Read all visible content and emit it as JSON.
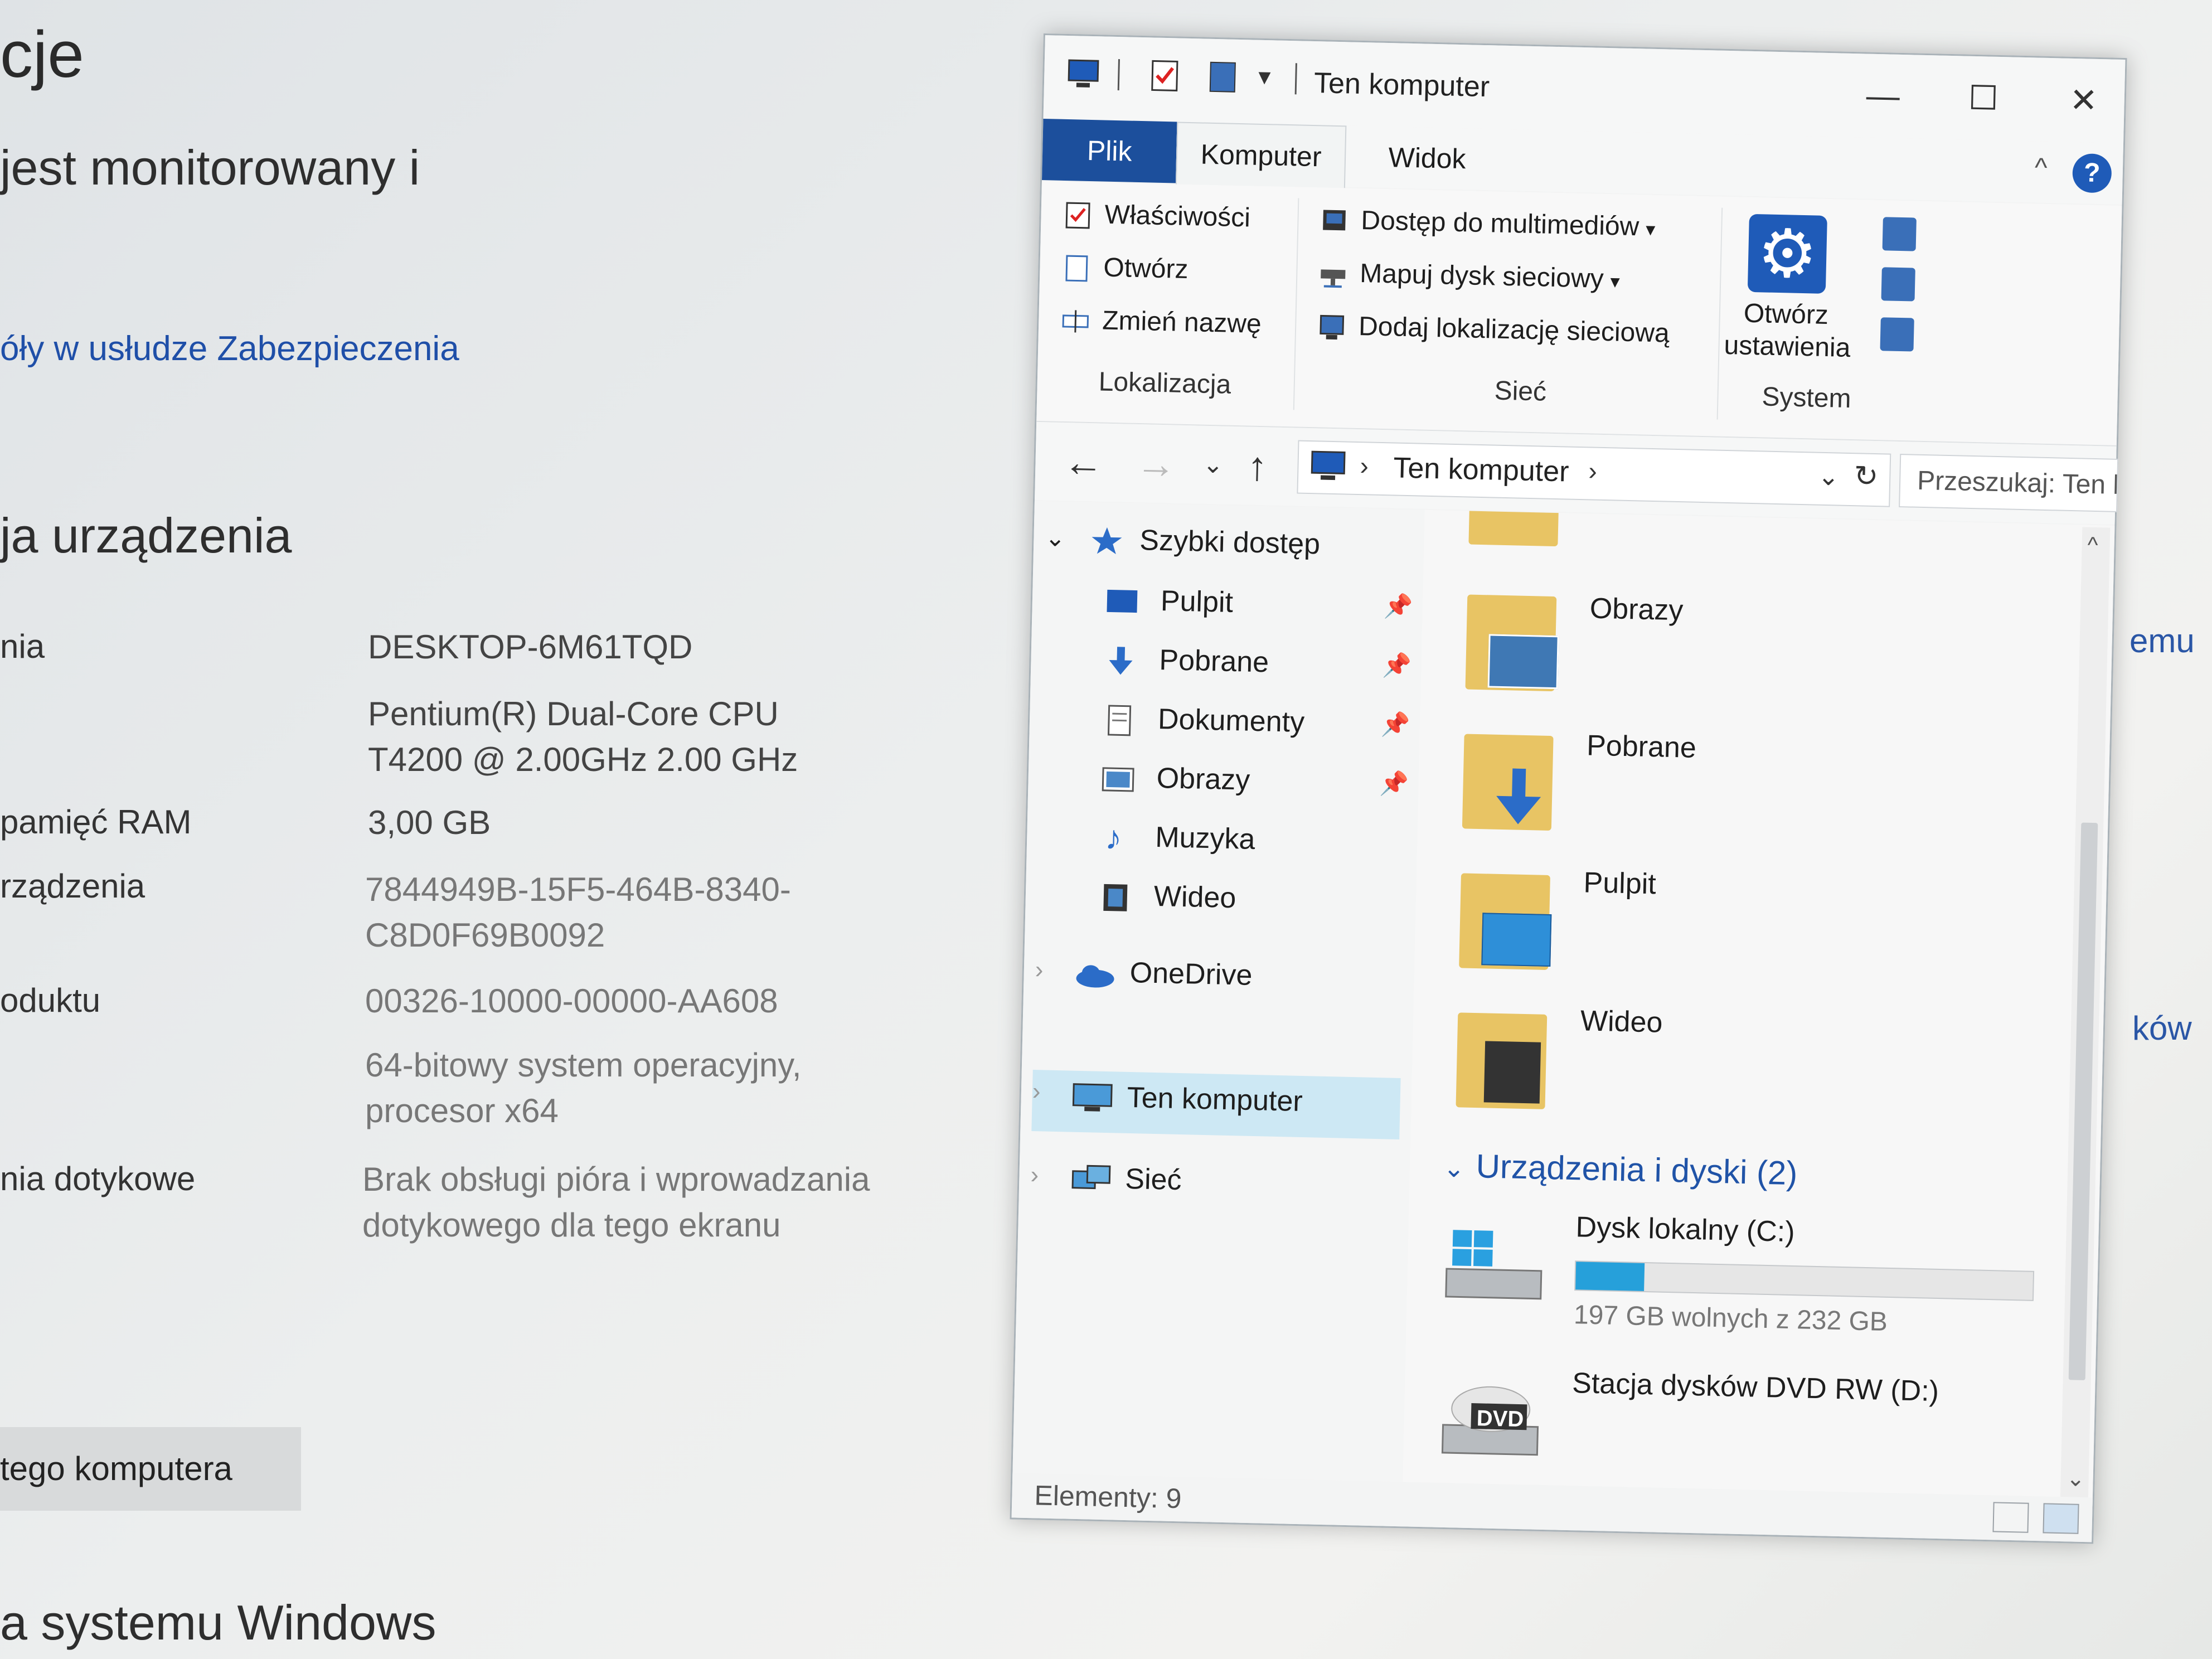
{
  "background": {
    "heading_partial": "cje",
    "subtitle_partial": "jest monitorowany i",
    "security_link": "óły w usłudze Zabezpieczenia",
    "device_section_title": "ja urządzenia",
    "specs": [
      {
        "label": "nia",
        "value": "DESKTOP-6M61TQD"
      },
      {
        "label": "",
        "value": "Pentium(R) Dual-Core CPU T4200  @ 2.00GHz   2.00 GHz"
      },
      {
        "label": "pamięć RAM",
        "value": "3,00 GB"
      },
      {
        "label": "rządzenia",
        "value": "7844949B-15F5-464B-8340-C8D0F69B0092"
      },
      {
        "label": "oduktu",
        "value": "00326-10000-00000-AA608"
      },
      {
        "label": "",
        "value": "64-bitowy system operacyjny, procesor x64"
      },
      {
        "label": "nia dotykowe",
        "value": "Brak obsługi pióra i wprowadzania dotykowego dla tego ekranu"
      }
    ],
    "rename_button": "tego komputera",
    "windows_section": "a systemu Windows",
    "right_partial_1": "emu",
    "right_partial_2": "ków"
  },
  "explorer": {
    "title": "Ten komputer",
    "tabs": {
      "file": "Plik",
      "computer": "Komputer",
      "view": "Widok"
    },
    "ribbon": {
      "location": {
        "group_label": "Lokalizacja",
        "properties": "Właściwości",
        "open": "Otwórz",
        "rename": "Zmień nazwę"
      },
      "network": {
        "group_label": "Sieć",
        "media_access": "Dostęp do multimediów",
        "map_drive": "Mapuj dysk sieciowy",
        "add_location": "Dodaj lokalizację sieciową"
      },
      "system": {
        "group_label": "System",
        "open_settings": "Otwórz ustawienia"
      }
    },
    "address": {
      "path": "Ten komputer",
      "search_placeholder": "Przeszukaj: Ten ko"
    },
    "nav": {
      "quick_access": "Szybki dostęp",
      "items": [
        "Pulpit",
        "Pobrane",
        "Dokumenty",
        "Obrazy",
        "Muzyka",
        "Wideo"
      ],
      "onedrive": "OneDrive",
      "this_pc": "Ten komputer",
      "network": "Sieć"
    },
    "folders": [
      "Obrazy",
      "Pobrane",
      "Pulpit",
      "Wideo"
    ],
    "devices": {
      "heading": "Urządzenia i dyski (2)",
      "drive_c": {
        "name": "Dysk lokalny (C:)",
        "free": "197 GB wolnych z 232 GB",
        "used_fraction": 0.15
      },
      "drive_d": {
        "name": "Stacja dysków DVD RW (D:)",
        "badge": "DVD"
      }
    },
    "status": "Elementy: 9"
  },
  "colors": {
    "accent": "#1c4f9c",
    "link": "#2053a7",
    "progress": "#26a0da",
    "folder": "#e8c464"
  }
}
